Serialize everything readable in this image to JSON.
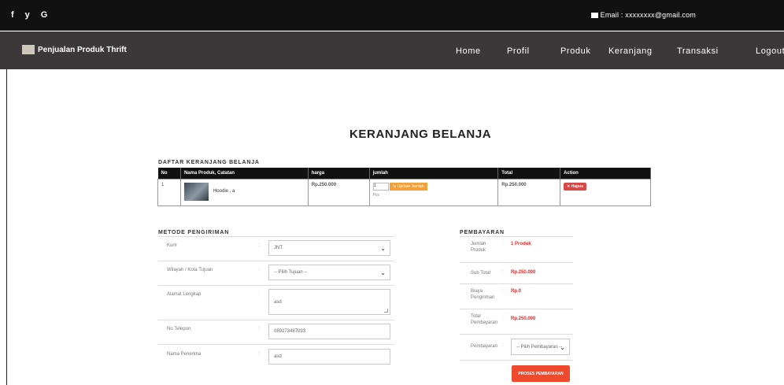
{
  "topbar": {
    "social": [
      "f",
      "y",
      "G"
    ],
    "email": "Email : xxxxxxxx@gmail.com"
  },
  "navbar": {
    "brand": "Penjualan Produk Thrift",
    "items": [
      "Home",
      "Profil",
      "Produk",
      "Keranjang",
      "Transaksi",
      "Logout"
    ]
  },
  "page_title": "KERANJANG BELANJA",
  "cart": {
    "label": "DAFTAR KERANJANG BELANJA",
    "headers": [
      "No",
      "Nama Produk, Catatan",
      "harga",
      "jumlah",
      "Total",
      "Action"
    ],
    "row": {
      "no": "1",
      "name": "Hoodie , a",
      "price": "Rp.250.000",
      "qty": "1",
      "update_label": "Update Jumlah",
      "unit": "Pcs",
      "total": "Rp.250.000",
      "delete_label": "Hapus"
    }
  },
  "shipping": {
    "label": "METODE PENGIRIMAN",
    "fields": [
      {
        "label": "Kurir",
        "value": "JNT"
      },
      {
        "label": "Wilayah / Kota Tujuan",
        "value": "-- Pilih Tujuan --"
      },
      {
        "label": "Alamat Lengkap",
        "value": "asd"
      },
      {
        "label": "No Telepon",
        "value": "089273487093"
      },
      {
        "label": "Nama Penerima",
        "value": "asd"
      }
    ]
  },
  "payment": {
    "label": "PEMBAYARAN",
    "rows": [
      {
        "label": "Jumlah Produk",
        "value": "1 Produk"
      },
      {
        "label": "Sub Total",
        "value": "Rp.250.000"
      },
      {
        "label": "Biaya Pengiriman",
        "value": "Rp.0"
      },
      {
        "label": "Total Pembayaran",
        "value": "Rp.250.000"
      },
      {
        "label": "Pembayaran",
        "value": "-- Pilih Pembayaran --"
      }
    ],
    "button": "PROSES PEMBAYARAN"
  }
}
